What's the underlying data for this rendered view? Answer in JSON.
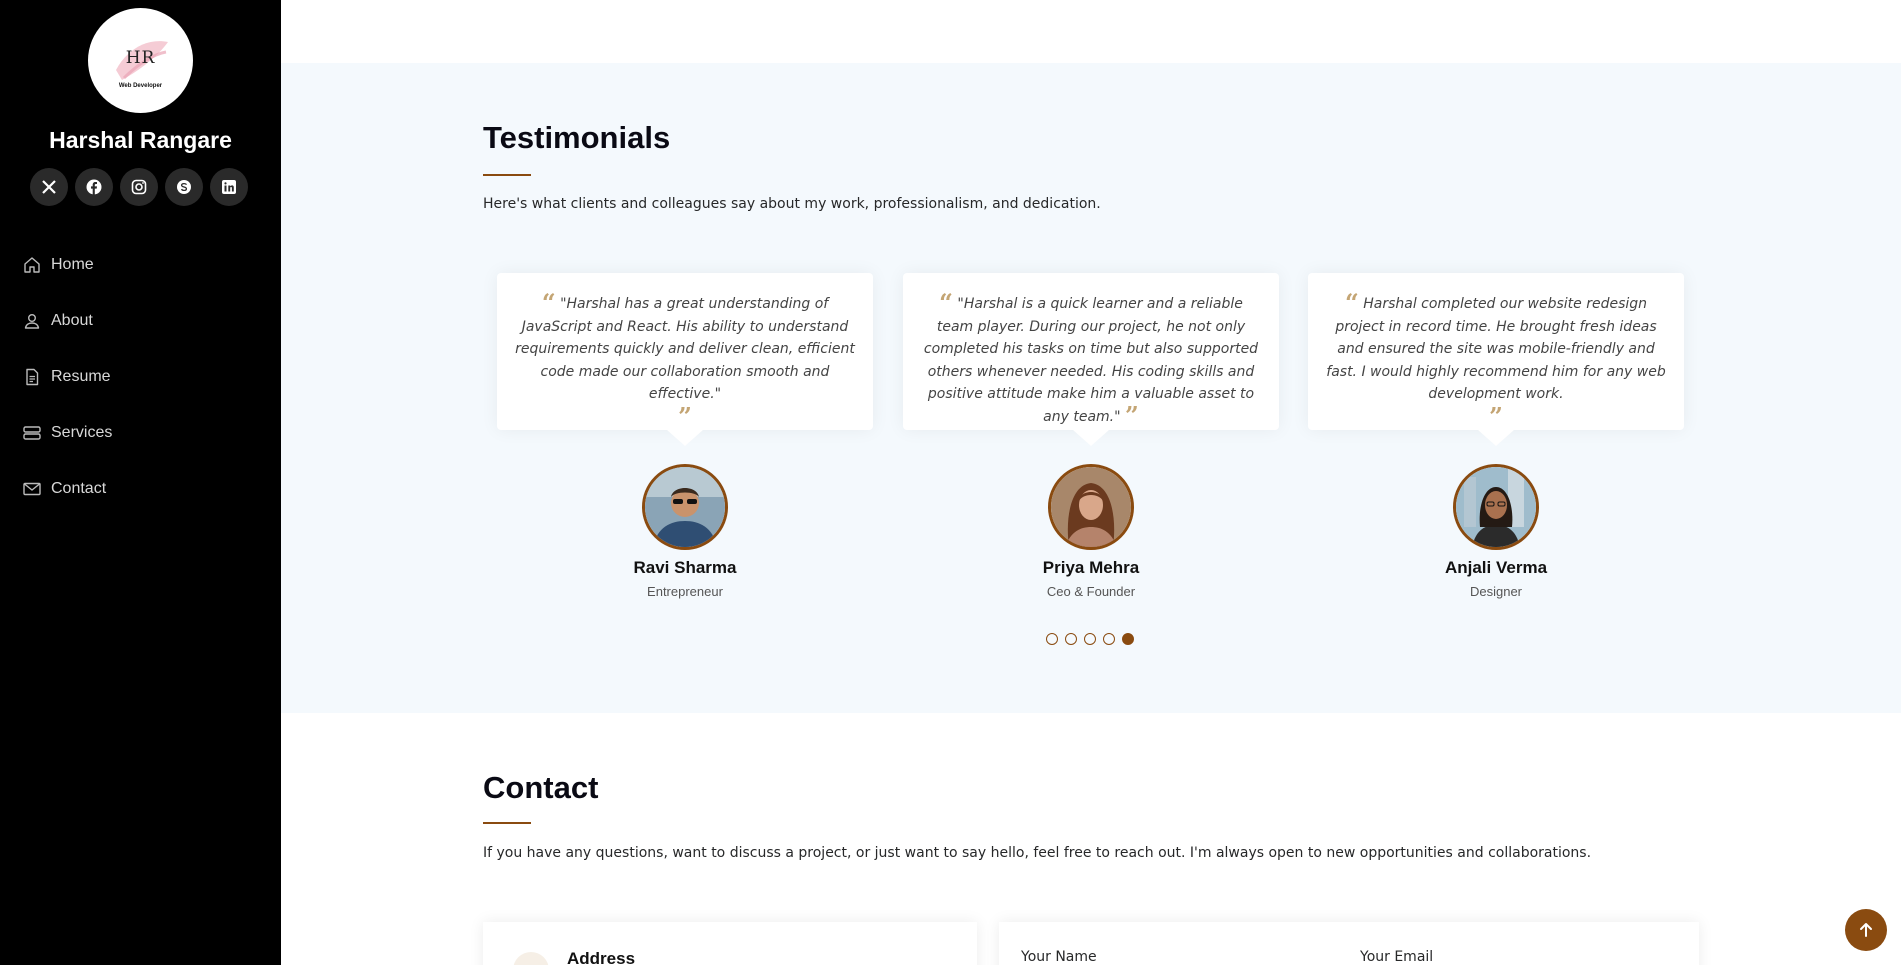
{
  "sidebar": {
    "logo_text": "HR",
    "logo_subtitle": "Web Developer",
    "name": "Harshal Rangare",
    "socials": [
      "x-icon",
      "facebook-icon",
      "instagram-icon",
      "skype-icon",
      "linkedin-icon"
    ],
    "nav": [
      {
        "label": "Home",
        "icon": "house-icon"
      },
      {
        "label": "About",
        "icon": "person-icon"
      },
      {
        "label": "Resume",
        "icon": "file-icon"
      },
      {
        "label": "Services",
        "icon": "server-icon"
      },
      {
        "label": "Contact",
        "icon": "envelope-icon"
      }
    ]
  },
  "testimonials": {
    "title": "Testimonials",
    "description": "Here's what clients and colleagues say about my work, professionalism, and dedication.",
    "items": [
      {
        "quote": "\"Harshal has a great understanding of JavaScript and React. His ability to understand requirements quickly and deliver clean, efficient code made our collaboration smooth and effective.\"",
        "name": "Ravi Sharma",
        "role": "Entrepreneur"
      },
      {
        "quote": "\"Harshal is a quick learner and a reliable team player. During our project, he not only completed his tasks on time but also supported others whenever needed. His coding skills and positive attitude make him a valuable asset to any team.\"",
        "name": "Priya Mehra",
        "role": "Ceo & Founder"
      },
      {
        "quote": "Harshal completed our website redesign project in record time. He brought fresh ideas and ensured the site was mobile-friendly and fast. I would highly recommend him for any web development work.",
        "name": "Anjali Verma",
        "role": "Designer"
      }
    ],
    "pagination": {
      "count": 5,
      "active_index": 4
    }
  },
  "contact": {
    "title": "Contact",
    "description": "If you have any questions, want to discuss a project, or just want to say hello, feel free to reach out. I'm always open to new opportunities and collaborations.",
    "address_title": "Address",
    "form": {
      "name_label": "Your Name",
      "email_label": "Your Email"
    }
  },
  "colors": {
    "accent": "#8a4b10",
    "sidebar_bg": "#000000",
    "section_bg": "#f4f9fd"
  }
}
